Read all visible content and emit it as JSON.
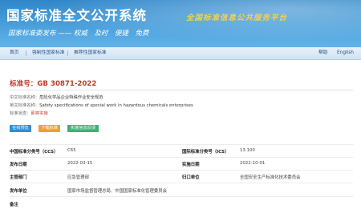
{
  "header": {
    "title": "国家标准全文公开系统",
    "slogan": "国家标准委发布 —— 权威　及时　便捷　免费",
    "motto": "全国标准信息公共服务平台"
  },
  "nav": {
    "home": "首页",
    "mandatory": "强制性国家标准",
    "recommended": "推荐性国家标准",
    "help": "帮助",
    "english": "English"
  },
  "standard": {
    "number": "标准号：GB 30871-2022",
    "cn_name_label": "中文标准名称：",
    "cn_name": "危险化学品企业特殊作业安全规范",
    "en_name_label": "英文标准名称：",
    "en_name": "Safety specifications of special work in hazardous chemicals enterprises",
    "status_label": "标准状态：",
    "status": "即将实施"
  },
  "buttons": {
    "preview": "在线预览",
    "download": "下载标准",
    "system": "实施信息反馈"
  },
  "details": {
    "ccs_label": "中国标准分类号（CCS）",
    "ccs": "C65",
    "ics_label": "国际标准分类号（ICS）",
    "ics": "13.100",
    "pub_date_label": "发布日期",
    "pub_date": "2022-03-15",
    "impl_date_label": "实施日期",
    "impl_date": "2022-10-01",
    "dept_label": "主管部门",
    "dept": "应急管理部",
    "central_label": "归口单位",
    "central": "全国安全生产标准化技术委员会",
    "issuer_label": "发布单位",
    "issuer": "国家市场监督管理总局、中国国家标准化管理委员会",
    "remark_label": "备注",
    "remark": ""
  },
  "colors": {
    "banner": "#2f86c9",
    "std_red": "#c0392b",
    "btn_blue": "#2d8fd5",
    "btn_orange": "#f0a030",
    "btn_green": "#3bb273",
    "motto_gold": "#f3d24a"
  }
}
